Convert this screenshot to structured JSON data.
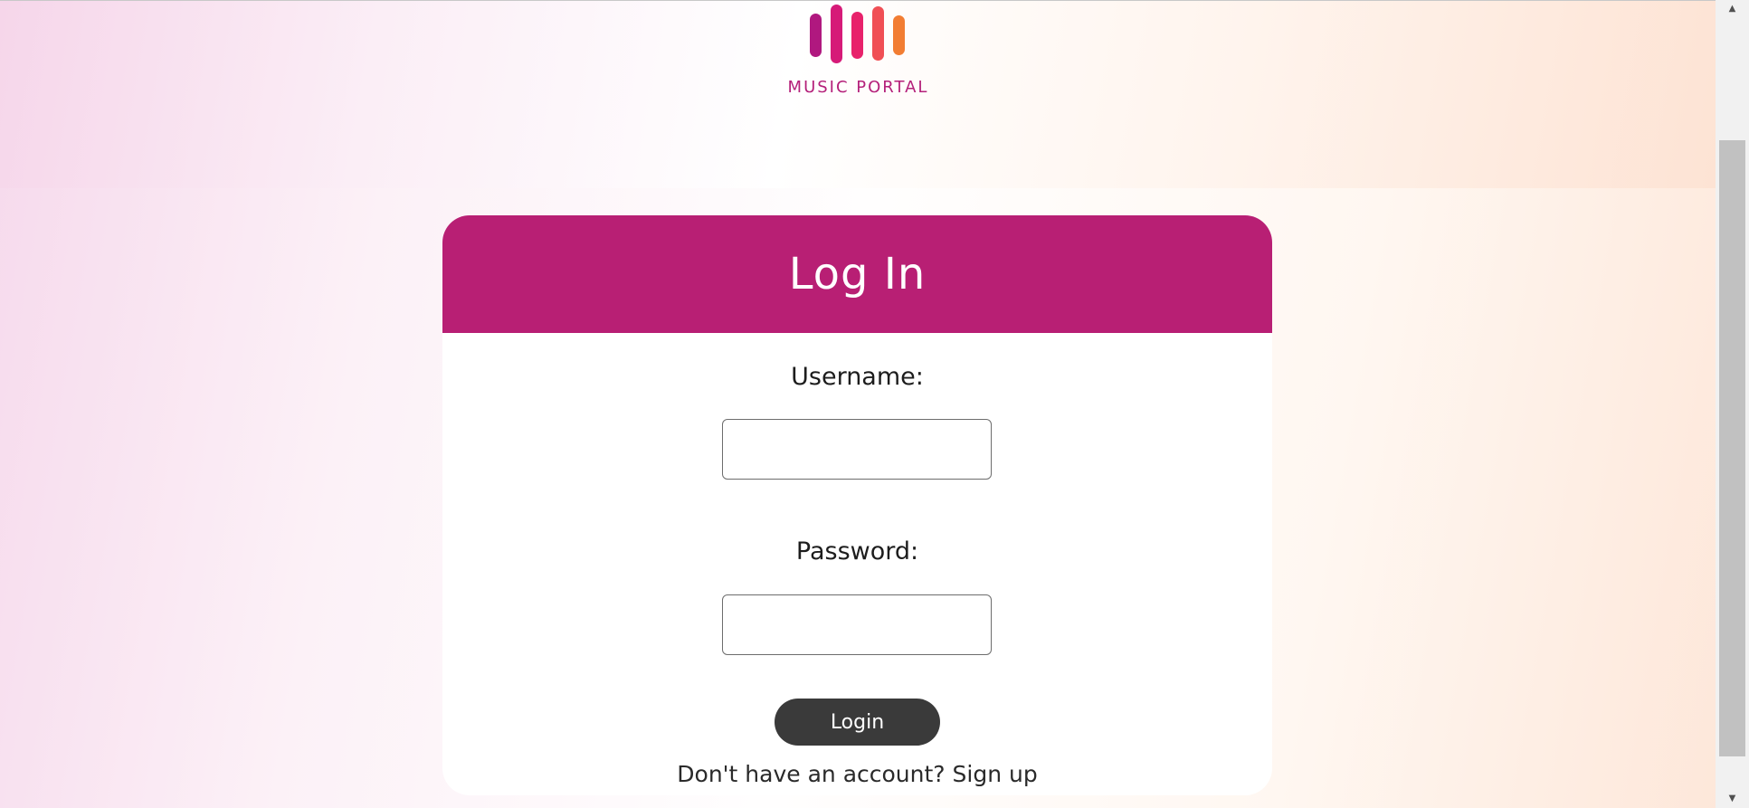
{
  "brand": {
    "name": "MUSIC PORTAL",
    "logo_icon": "equalizer-bars-icon",
    "colors": [
      "#b0187f",
      "#d61a78",
      "#e8226b",
      "#f04f55",
      "#f27d33"
    ]
  },
  "card": {
    "title": "Log In",
    "header_color": "#b81f74"
  },
  "form": {
    "username_label": "Username:",
    "username_value": "",
    "password_label": "Password:",
    "password_value": "",
    "submit_label": "Login",
    "signup_prompt": "Don't have an account?",
    "signup_link": "Sign up"
  },
  "scrollbar": {
    "up_icon": "scroll-up-arrow-icon",
    "down_icon": "scroll-down-arrow-icon"
  }
}
